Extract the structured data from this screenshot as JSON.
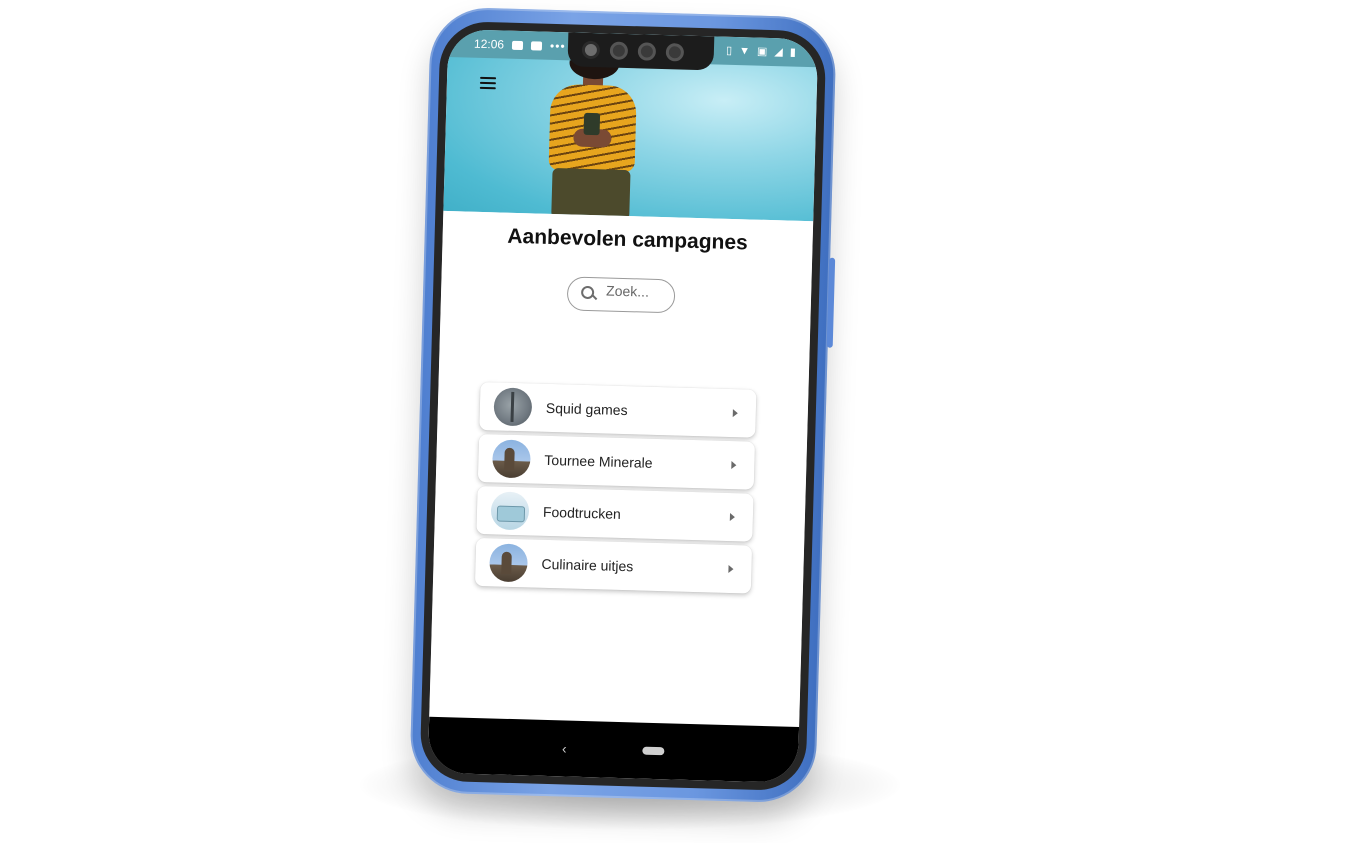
{
  "status_bar": {
    "time": "12:06",
    "left_icons": [
      "image-icon",
      "youtube-icon",
      "more-dots-icon"
    ],
    "right_icons": [
      "vibrate-icon",
      "wifi-icon",
      "lte-icon",
      "signal-icon",
      "battery-icon"
    ]
  },
  "header": {
    "menu_icon": "hamburger-menu-icon",
    "hero_image": "woman-holding-phone-photo"
  },
  "main": {
    "title": "Aanbevolen campagnes",
    "search": {
      "placeholder": "Zoek...",
      "value": ""
    },
    "campaigns": [
      {
        "label": "Squid games",
        "thumbnail": "squid-games-thumbnail"
      },
      {
        "label": "Tournee Minerale",
        "thumbnail": "church-town-thumbnail"
      },
      {
        "label": "Foodtrucken",
        "thumbnail": "foodtruck-thumbnail"
      },
      {
        "label": "Culinaire uitjes",
        "thumbnail": "church-town-thumbnail"
      }
    ]
  },
  "nav_bar": {
    "back_glyph": "‹"
  },
  "colors": {
    "phone_frame": "#6b97e0",
    "hero_bg": "#4fbbd2",
    "shirt": "#e7a51e"
  }
}
